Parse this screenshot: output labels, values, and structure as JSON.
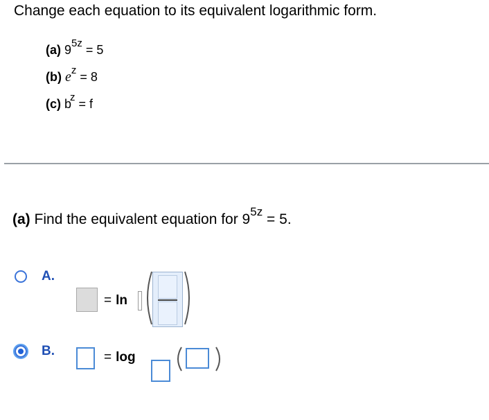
{
  "instruction": "Change each equation to its equivalent logarithmic form.",
  "parts": [
    {
      "label": "(a)",
      "base": "9",
      "exponent": "5z",
      "rhs": "= 5"
    },
    {
      "label": "(b)",
      "base": "e",
      "exponent": "z",
      "rhs": "= 8"
    },
    {
      "label": "(c)",
      "base": "b",
      "exponent": "z",
      "rhs": "= f"
    }
  ],
  "question": {
    "label": "(a)",
    "text": "Find the equivalent equation for 9",
    "exponent": "5z",
    "rhs": "= 5."
  },
  "options": [
    {
      "letter": "A.",
      "selected": false,
      "equals": "=",
      "func": "ln"
    },
    {
      "letter": "B.",
      "selected": true,
      "equals": "=",
      "func": "log"
    }
  ],
  "colors": {
    "accent": "#1f60d6",
    "option_letter": "#1f4fb4",
    "divider": "#9aa0a6"
  }
}
